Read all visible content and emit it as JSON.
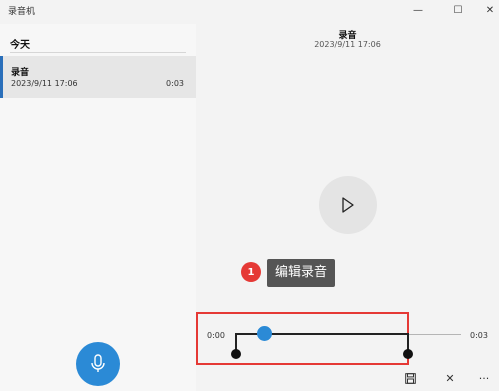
{
  "window": {
    "title": "录音机",
    "min_glyph": "—",
    "max_glyph": "☐",
    "close_glyph": "✕"
  },
  "sidebar": {
    "section_header": "今天",
    "items": [
      {
        "name": "录音",
        "date": "2023/9/11 17:06",
        "duration": "0:03",
        "selected": true
      }
    ],
    "record_icon": "microphone-icon"
  },
  "main": {
    "title": "录音",
    "date": "2023/9/11 17:06",
    "play_icon": "play-icon"
  },
  "annotation": {
    "badge": "1",
    "text": "编辑录音",
    "color": "#e53935"
  },
  "timeline": {
    "start_time": "0:00",
    "end_time": "0:03",
    "playhead_fraction": 0.13,
    "trim_start_fraction": 0.0,
    "trim_end_fraction": 0.76
  },
  "toolbar": {
    "save_icon": "save-icon",
    "cancel_glyph": "✕",
    "more_glyph": "···"
  },
  "colors": {
    "accent": "#2b8ad6",
    "highlight_border": "#e53935",
    "selected_item_bg": "#e6e6e6"
  }
}
